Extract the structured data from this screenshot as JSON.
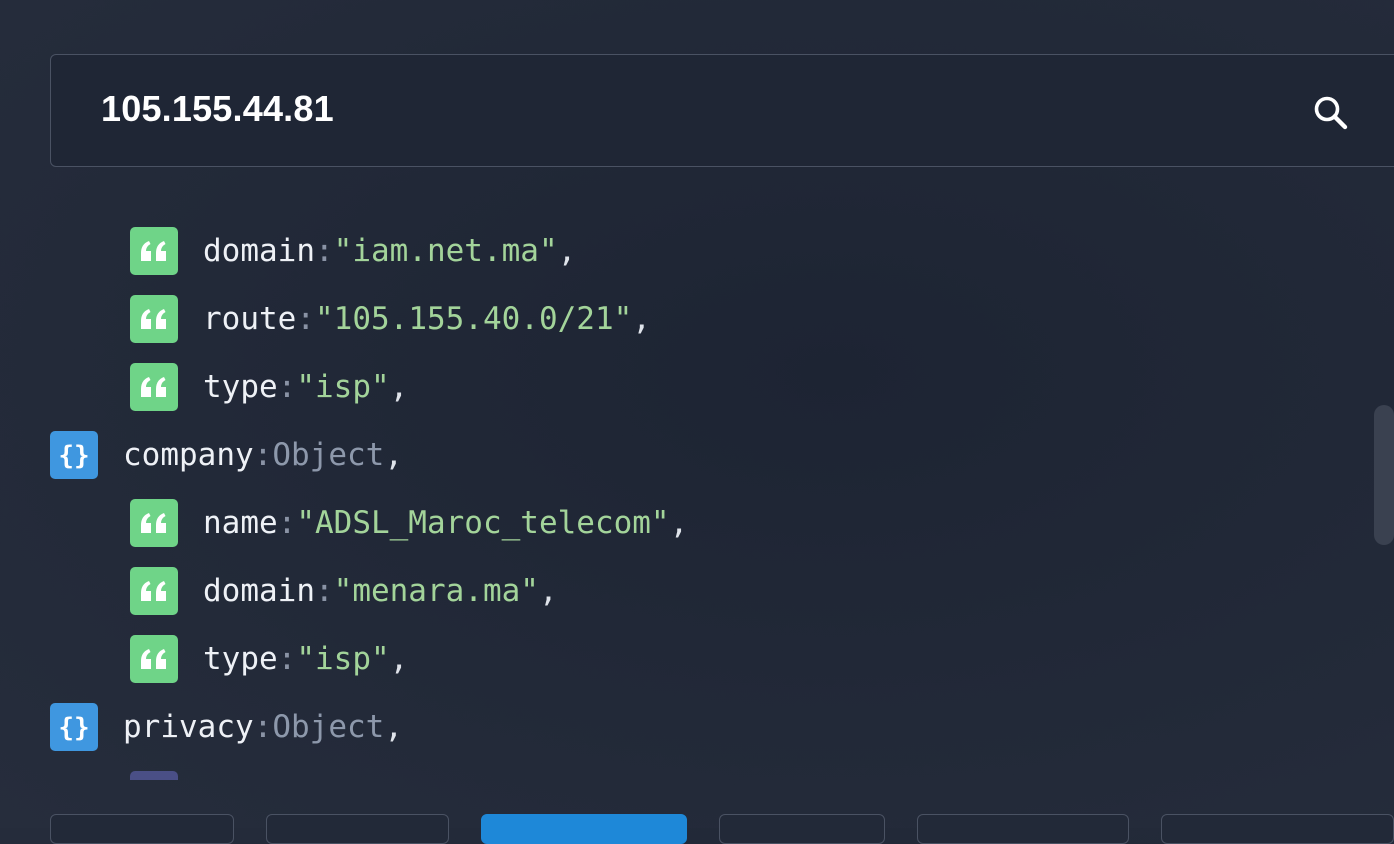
{
  "search": {
    "value": "105.155.44.81",
    "icon": "search-icon"
  },
  "json_rows": [
    {
      "type": "string",
      "key": "domain",
      "value": "\"iam.net.ma\""
    },
    {
      "type": "string",
      "key": "route",
      "value": "\"105.155.40.0/21\""
    },
    {
      "type": "string",
      "key": "type",
      "value": "\"isp\""
    },
    {
      "type": "object",
      "key": "company",
      "value": "Object"
    },
    {
      "type": "string",
      "key": "name",
      "value": "\"ADSL_Maroc_telecom\""
    },
    {
      "type": "string",
      "key": "domain",
      "value": "\"menara.ma\""
    },
    {
      "type": "string",
      "key": "type",
      "value": "\"isp\""
    },
    {
      "type": "object",
      "key": "privacy",
      "value": "Object"
    }
  ],
  "punctuation": {
    "colon": ":",
    "comma": ","
  },
  "colors": {
    "background": "#222938",
    "string_badge": "#6fd488",
    "object_badge": "#3f97e0",
    "string_value": "#a3d49a",
    "active_button": "#1e88d8"
  }
}
